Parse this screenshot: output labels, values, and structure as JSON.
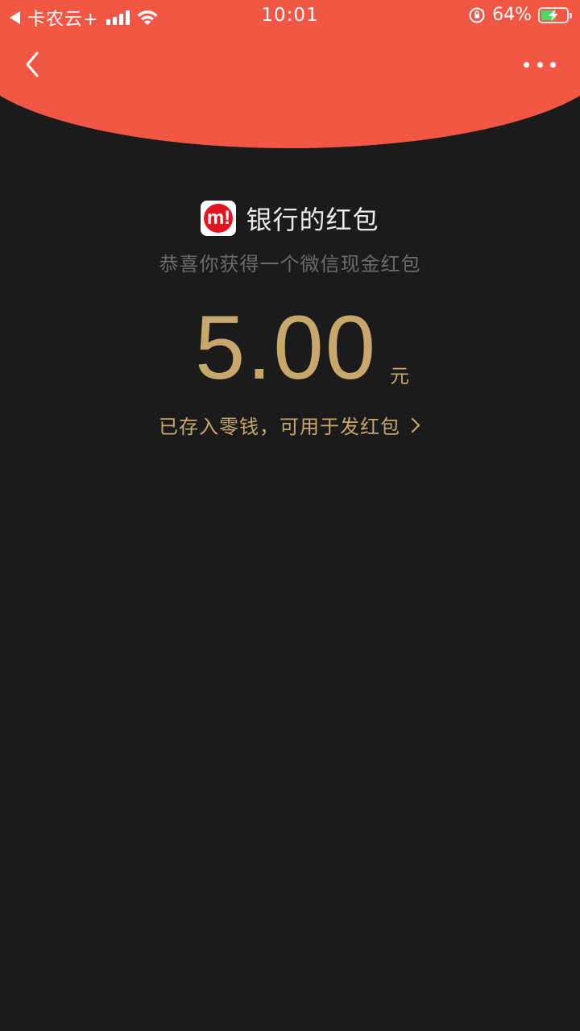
{
  "status_bar": {
    "carrier": "卡农云+",
    "time": "10:01",
    "battery_percent": "64%",
    "battery_level": 0.64,
    "battery_fill_color": "#4cd964"
  },
  "header": {
    "background_color": "#f25745",
    "back_icon": "chevron-left-icon",
    "more_icon": "more-dots-icon"
  },
  "red_packet": {
    "sender_logo_text": "m!",
    "sender_name": "银行的红包",
    "subtitle": "恭喜你获得一个微信现金红包",
    "amount": "5.00",
    "unit": "元",
    "saved_text": "已存入零钱，可用于发红包",
    "accent_color": "#c8a86a"
  }
}
